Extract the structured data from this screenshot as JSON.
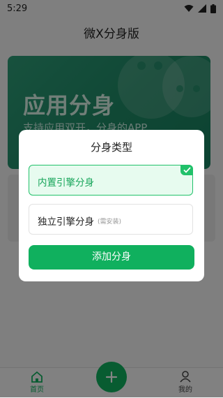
{
  "status_bar": {
    "time": "5:29"
  },
  "app": {
    "title": "微X分身版"
  },
  "banner": {
    "title": "应用分身",
    "subtitle": "支持应用双开，分身的APP"
  },
  "dialog": {
    "title": "分身类型",
    "options": [
      {
        "label": "内置引擎分身",
        "note": "",
        "selected": true
      },
      {
        "label": "独立引擎分身",
        "note": "(需安装)",
        "selected": false
      }
    ],
    "confirm_label": "添加分身"
  },
  "tabbar": {
    "home_label": "首页",
    "mine_label": "我的"
  },
  "colors": {
    "accent": "#10b05e",
    "selected_bg": "#e7fbef",
    "banner": "#1f8a66"
  }
}
